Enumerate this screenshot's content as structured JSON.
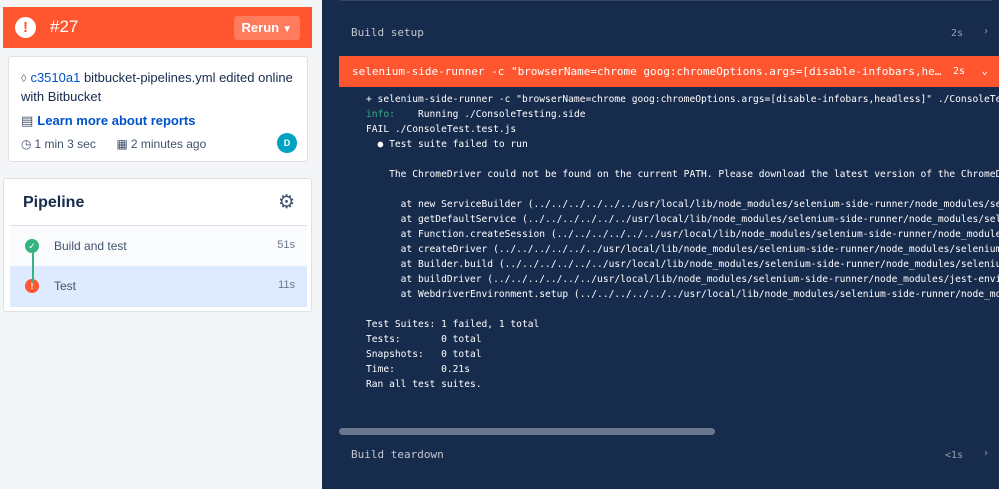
{
  "build": {
    "number": "#27",
    "rerun_label": "Rerun",
    "commit_hash": "c3510a1",
    "commit_message": "bitbucket-pipelines.yml edited online with Bitbucket",
    "reports_link": "Learn more about reports",
    "duration": "1 min 3 sec",
    "started": "2 minutes ago",
    "avatar_initial": "D",
    "status_color": "#ff5630"
  },
  "pipeline": {
    "title": "Pipeline",
    "steps": [
      {
        "name": "Build and test",
        "duration": "51s",
        "status": "success"
      },
      {
        "name": "Test",
        "duration": "11s",
        "status": "failed"
      }
    ]
  },
  "log": {
    "setup_label": "Build setup",
    "setup_time": "2s",
    "command": "selenium-side-runner -c \"browserName=chrome goog:chromeOptions.args=[disable-infobars,he…",
    "command_time": "2s",
    "lines": [
      "+ selenium-side-runner -c \"browserName=chrome goog:chromeOptions.args=[disable-infobars,headless]\" ./ConsoleTesting.s",
      "info:    Running ./ConsoleTesting.side",
      "FAIL ./ConsoleTest.test.js",
      "  ● Test suite failed to run",
      "",
      "    The ChromeDriver could not be found on the current PATH. Please download the latest version of the ChromeDriver f",
      "",
      "      at new ServiceBuilder (../../../../../../usr/local/lib/node_modules/selenium-side-runner/node_modules/selenium-",
      "      at getDefaultService (../../../../../../usr/local/lib/node_modules/selenium-side-runner/node_modules/selenium-w",
      "      at Function.createSession (../../../../../../usr/local/lib/node_modules/selenium-side-runner/node_modules/selen",
      "      at createDriver (../../../../../../usr/local/lib/node_modules/selenium-side-runner/node_modules/selenium-webdri",
      "      at Builder.build (../../../../../../usr/local/lib/node_modules/selenium-side-runner/node_modules/selenium-webdr",
      "      at buildDriver (../../../../../../usr/local/lib/node_modules/selenium-side-runner/node_modules/jest-environment",
      "      at WebdriverEnvironment.setup (../../../../../../usr/local/lib/node_modules/selenium-side-runner/node_modules/j",
      "",
      "Test Suites: 1 failed, 1 total",
      "Tests:       0 total",
      "Snapshots:   0 total",
      "Time:        0.21s",
      "Ran all test suites."
    ],
    "teardown_label": "Build teardown",
    "teardown_time": "<1s"
  }
}
